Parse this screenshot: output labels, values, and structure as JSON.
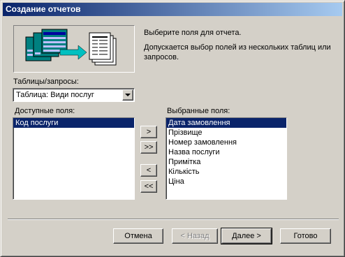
{
  "window": {
    "title": "Создание отчетов"
  },
  "description": {
    "line1": "Выберите поля для отчета.",
    "line2": "Допускается выбор полей из нескольких таблиц или запросов."
  },
  "tables_label": "Таблицы/запросы:",
  "tables_combo": {
    "value": "Таблица: Види послуг"
  },
  "available": {
    "label": "Доступные поля:",
    "items": [
      "Код послуги"
    ]
  },
  "selected": {
    "label": "Выбранные поля:",
    "items": [
      "Дата замовлення",
      "Прізвище",
      "Номер замовлення",
      "Назва послуги",
      "Примітка",
      "Кількість",
      "Ціна"
    ]
  },
  "move_buttons": {
    "add": ">",
    "add_all": ">>",
    "remove": "<",
    "remove_all": "<<"
  },
  "footer": {
    "cancel": "Отмена",
    "back": "< Назад",
    "next": "Далее >",
    "finish": "Готово"
  },
  "colors": {
    "face": "#d4d0c8",
    "title_start": "#0a246a",
    "title_end": "#a6caf0",
    "highlight": "#0a246a",
    "illustration_teal": "#008080",
    "illustration_blue": "#0000a0",
    "illustration_arrow": "#00c0c0"
  }
}
